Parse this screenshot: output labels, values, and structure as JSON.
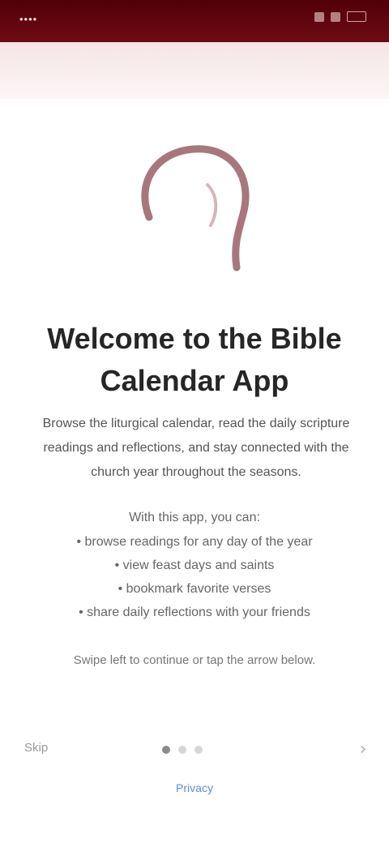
{
  "status_bar": {
    "time": "••••"
  },
  "welcome": {
    "title": "Welcome to the Bible Calendar App",
    "intro": "Browse the liturgical calendar, read the daily scripture readings and reflections, and stay connected with the church year throughout the seasons."
  },
  "features": {
    "intro": "With this app, you can:",
    "items": [
      "• browse readings for any day of the year",
      "• view feast days and saints",
      "• bookmark favorite verses",
      "• share daily reflections with your friends"
    ]
  },
  "footer": {
    "note": "Swipe left to continue or tap the arrow below."
  },
  "nav": {
    "skip_label": "Skip",
    "next_icon": "chevron-right-icon",
    "next_glyph": "›",
    "pages": 3,
    "active_page": 1
  },
  "links": {
    "privacy": "Privacy"
  },
  "colors": {
    "status_bar": "#6e0b14",
    "header_band": "#f6e4e5",
    "logo": "#8a4a52",
    "title": "#262626",
    "link": "#5a8fd6"
  }
}
